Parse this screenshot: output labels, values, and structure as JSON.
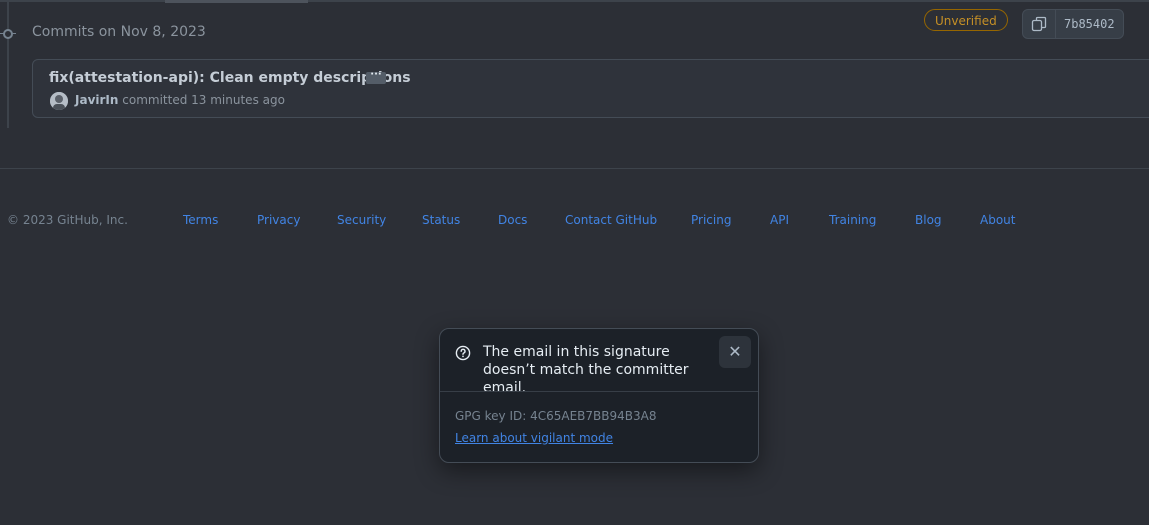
{
  "timeline": {
    "date_heading": "Commits on Nov 8, 2023"
  },
  "commit": {
    "title": "fix(attestation-api): Clean empty descriptions",
    "ellipsis": "···",
    "author": "JavirIn",
    "action": "committed",
    "time": "13 minutes ago",
    "badge": "Unverified",
    "sha": "7b85402",
    "copy_icon": "copy-icon"
  },
  "footer": {
    "copyright": "© 2023 GitHub, Inc.",
    "links": [
      "Terms",
      "Privacy",
      "Security",
      "Status",
      "Docs",
      "Contact GitHub",
      "Pricing",
      "API",
      "Training",
      "Blog",
      "About"
    ]
  },
  "popover": {
    "icon": "question-icon",
    "message": "The email in this signature doesn’t match the committer email.",
    "close_icon": "close-icon",
    "gpg_key": "GPG key ID: 4C65AEB7BB94B3A8",
    "learn_link": "Learn about vigilant mode"
  },
  "colors": {
    "background": "#2c2f36",
    "unverified": "#c69026",
    "link": "#4184e4"
  }
}
